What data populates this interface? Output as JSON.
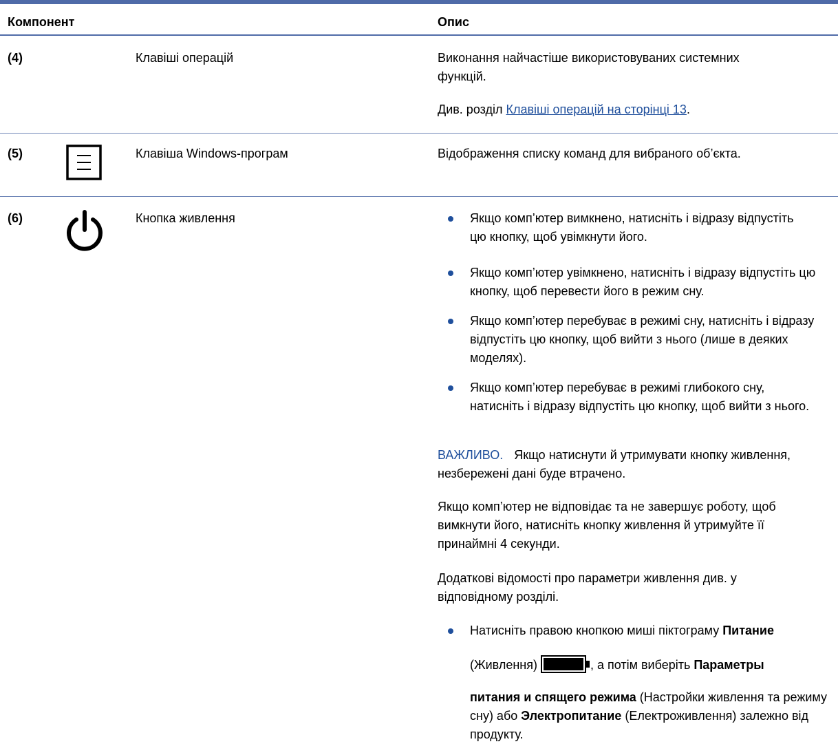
{
  "colors": {
    "accent": "#4f6ba8",
    "link": "#1f4f9c"
  },
  "header": {
    "component": "Компонент",
    "description": "Опис"
  },
  "rows": [
    {
      "number": "(4)",
      "component": "Клавіші операцій",
      "desc_line": "Виконання найчастіше використовуваних системних функцій.",
      "see_prefix": "Див. розділ ",
      "see_link": "Клавіші операцій на сторінці 13",
      "see_suffix": "."
    },
    {
      "number": "(5)",
      "icon": "windows-menu-icon",
      "component": "Клавіша Windows-програм",
      "desc_line": "Відображення списку команд для вибраного об’єкта."
    },
    {
      "number": "(6)",
      "icon": "power-icon",
      "component": "Кнопка живлення",
      "bullets": [
        "Якщо комп’ютер вимкнено, натисніть і відразу відпустіть цю кнопку, щоб увімкнути його.",
        "Якщо комп’ютер увімкнено, натисніть і відразу відпустіть цю кнопку, щоб перевести його в режим сну.",
        "Якщо комп’ютер перебуває в режимі сну, натисніть і відразу відпустіть цю кнопку, щоб вийти з нього (лише в деяких моделях).",
        "Якщо комп’ютер перебуває в режимі глибокого сну, натисніть і відразу відпустіть цю кнопку, щоб вийти з нього."
      ],
      "important_label": "ВАЖЛИВО.",
      "important_text": "Якщо натиснути й утримувати кнопку живлення, незбережені дані буде втрачено.",
      "para1": "Якщо комп’ютер не відповідає та не завершує роботу, щоб вимкнути його, натисніть кнопку живлення й утримуйте її принаймні 4 секунди.",
      "para2": "Додаткові відомості про параметри живлення див. у відповідному розділі.",
      "last_bullet": {
        "t1": "Натисніть правою кнопкою миші піктограму ",
        "b1": "Питание",
        "t2": "(Живлення) ",
        "battery_icon": "battery-icon",
        "t3": ", а потім виберіть ",
        "b2": "Параметры",
        "b3": "питания и спящего режима",
        "t4": " (Настройки живлення та режиму сну) або ",
        "b4": "Электропитание",
        "t5": " (Електроживлення) залежно від продукту."
      }
    }
  ]
}
